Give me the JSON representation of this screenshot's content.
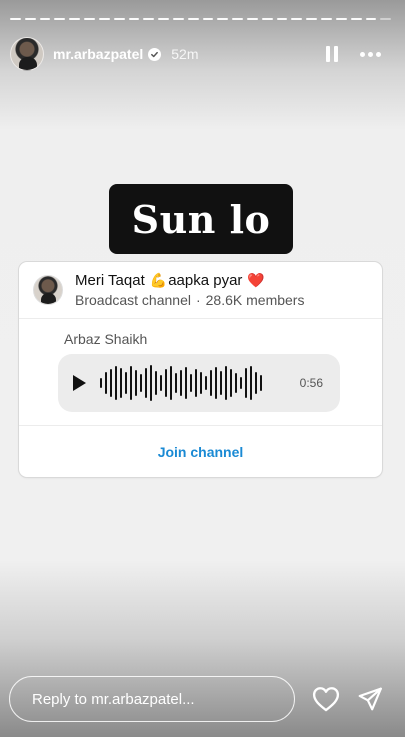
{
  "header": {
    "username": "mr.arbazpatel",
    "time_ago": "52m",
    "verified_icon": "verified-badge-icon",
    "pause_icon": "pause-icon",
    "more_icon": "more-icon"
  },
  "story": {
    "segments_total": 26,
    "sticker_text": "Sun lo"
  },
  "card": {
    "channel_name_part1": "Meri Taqat",
    "emoji_1": "💪",
    "channel_name_part2": "aapka pyar",
    "emoji_2": "❤️",
    "channel_type": "Broadcast channel",
    "separator": "·",
    "members": "28.6K members",
    "sender": "Arbaz Shaikh",
    "duration": "0:56",
    "join_label": "Join channel"
  },
  "reply": {
    "placeholder": "Reply to mr.arbazpatel..."
  },
  "colors": {
    "accent": "#1a8ad4"
  }
}
